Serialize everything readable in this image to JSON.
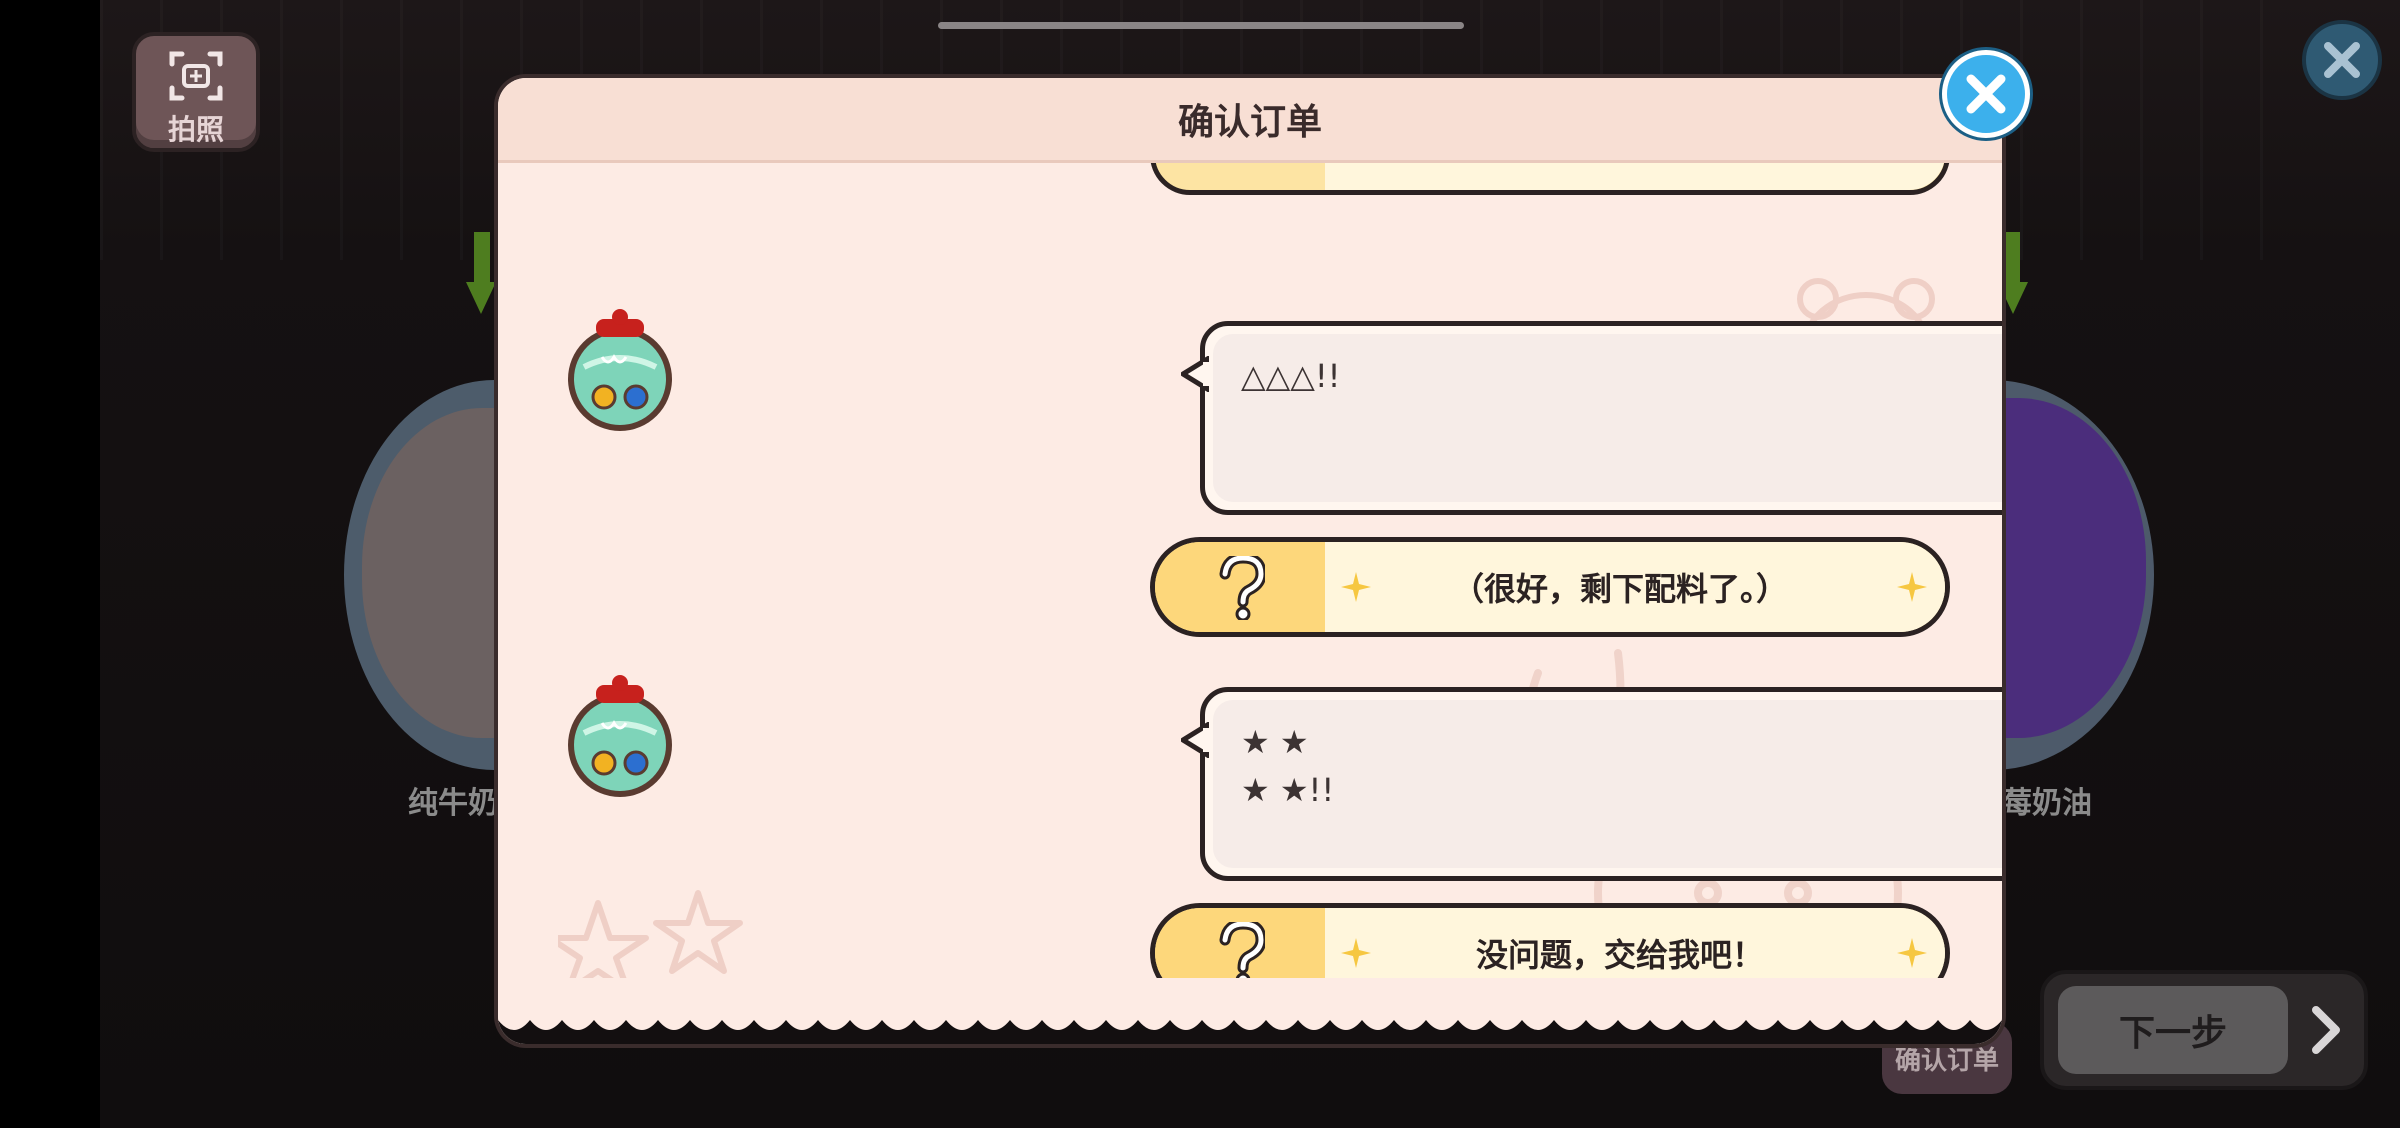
{
  "screen": {
    "photo_button_label": "拍照",
    "left_ingredient_label": "纯牛奶",
    "right_ingredient_label": "莓奶油",
    "next_button_label": "下一步",
    "confirm_chip_label": "确认订单"
  },
  "dialog": {
    "title": "确认订单",
    "messages": [
      {
        "speaker": "customer-jar",
        "text": "△△△!!"
      },
      {
        "speaker": "customer-jar",
        "text": "★ ★\n★ ★!!"
      }
    ],
    "choices": [
      {
        "label": "（很好，剩下配料了。）"
      },
      {
        "label": "没问题，交给我吧！"
      }
    ]
  },
  "icons": {
    "close": "close-icon",
    "camera": "camera-frame-icon",
    "question": "question-mark-icon",
    "sparkle": "sparkle-icon",
    "next": "chevron-right-icon"
  },
  "colors": {
    "dialog_bg": "#fdebe4",
    "choice_yellow": "#fdd77b",
    "close_blue": "#3cb0ec",
    "outline": "#2b2222"
  }
}
